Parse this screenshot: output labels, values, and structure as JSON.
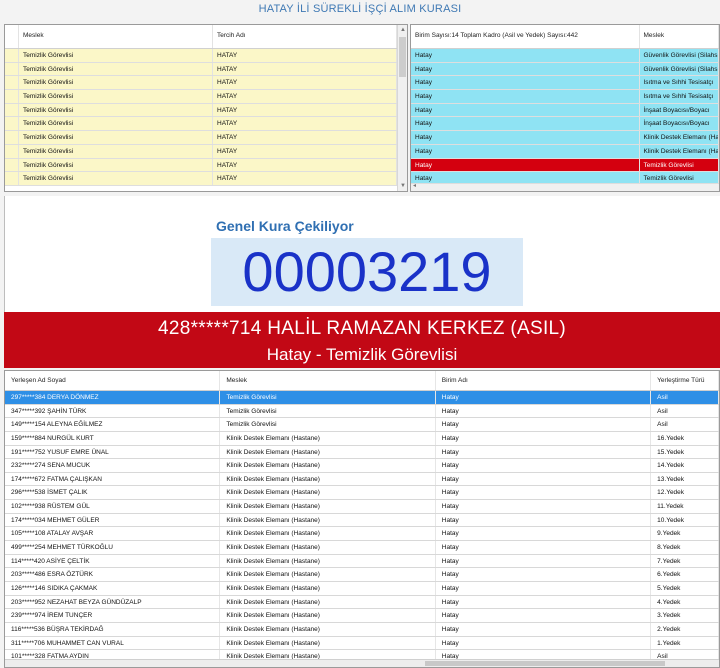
{
  "title": "HATAY İLİ SÜREKLİ İŞÇİ ALIM KURASI",
  "left_panel": {
    "columns": [
      "Meslek",
      "Tercih Adı"
    ],
    "rows": [
      [
        "Temizlik Görevlisi",
        "HATAY"
      ],
      [
        "Temizlik Görevlisi",
        "HATAY"
      ],
      [
        "Temizlik Görevlisi",
        "HATAY"
      ],
      [
        "Temizlik Görevlisi",
        "HATAY"
      ],
      [
        "Temizlik Görevlisi",
        "HATAY"
      ],
      [
        "Temizlik Görevlisi",
        "HATAY"
      ],
      [
        "Temizlik Görevlisi",
        "HATAY"
      ],
      [
        "Temizlik Görevlisi",
        "HATAY"
      ],
      [
        "Temizlik Görevlisi",
        "HATAY"
      ],
      [
        "Temizlik Görevlisi",
        "HATAY"
      ]
    ]
  },
  "right_panel": {
    "columns": [
      "Birim Sayısı:14 Toplam Kadro (Asil ve Yedek) Sayısı:442",
      "Meslek"
    ],
    "rows": [
      {
        "birim": "Hatay",
        "meslek": "Güvenlik Görevlisi (Silahsız)",
        "state": "normal"
      },
      {
        "birim": "Hatay",
        "meslek": "Güvenlik Görevlisi (Silahsız)",
        "state": "normal"
      },
      {
        "birim": "Hatay",
        "meslek": "Isıtma ve Sıhhi Tesisatçı",
        "state": "normal"
      },
      {
        "birim": "Hatay",
        "meslek": "Isıtma ve Sıhhi Tesisatçı",
        "state": "normal"
      },
      {
        "birim": "Hatay",
        "meslek": "İnşaat Boyacısı/Boyacı",
        "state": "normal"
      },
      {
        "birim": "Hatay",
        "meslek": "İnşaat Boyacısı/Boyacı",
        "state": "normal"
      },
      {
        "birim": "Hatay",
        "meslek": "Klinik Destek Elemanı (Hastane)",
        "state": "normal"
      },
      {
        "birim": "Hatay",
        "meslek": "Klinik Destek Elemanı (Hastane)",
        "state": "normal"
      },
      {
        "birim": "Hatay",
        "meslek": "Temizlik Görevlisi",
        "state": "active"
      },
      {
        "birim": "Hatay",
        "meslek": "Temizlik Görevlisi",
        "state": "normal"
      }
    ]
  },
  "draw": {
    "label": "Genel Kura Çekiliyor",
    "number": "00003219"
  },
  "winner": {
    "line1": "428*****714 HALİL RAMAZAN KERKEZ (ASIL)",
    "line2": "Hatay - Temizlik Görevlisi"
  },
  "results": {
    "columns": [
      "Yerleşen Ad Soyad",
      "Meslek",
      "Birim Adı",
      "Yerleştirme Türü"
    ],
    "rows": [
      [
        "297*****384 DERYA DÖNMEZ",
        "Temizlik Görevlisi",
        "Hatay",
        "Asil"
      ],
      [
        "347*****392 ŞAHİN TÜRK",
        "Temizlik Görevlisi",
        "Hatay",
        "Asil"
      ],
      [
        "149*****154 ALEYNA EĞİLMEZ",
        "Temizlik Görevlisi",
        "Hatay",
        "Asil"
      ],
      [
        "159*****884 NURGÜL KURT",
        "Klinik Destek Elemanı (Hastane)",
        "Hatay",
        "16.Yedek"
      ],
      [
        "191*****752 YUSUF EMRE ÜNAL",
        "Klinik Destek Elemanı (Hastane)",
        "Hatay",
        "15.Yedek"
      ],
      [
        "232*****274 SENA MUCUK",
        "Klinik Destek Elemanı (Hastane)",
        "Hatay",
        "14.Yedek"
      ],
      [
        "174*****672 FATMA ÇALIŞKAN",
        "Klinik Destek Elemanı (Hastane)",
        "Hatay",
        "13.Yedek"
      ],
      [
        "296*****538 İSMET ÇALIK",
        "Klinik Destek Elemanı (Hastane)",
        "Hatay",
        "12.Yedek"
      ],
      [
        "102*****938 RÜSTEM GÜL",
        "Klinik Destek Elemanı (Hastane)",
        "Hatay",
        "11.Yedek"
      ],
      [
        "174*****034 MEHMET GÜLER",
        "Klinik Destek Elemanı (Hastane)",
        "Hatay",
        "10.Yedek"
      ],
      [
        "105*****108 ATALAY AVŞAR",
        "Klinik Destek Elemanı (Hastane)",
        "Hatay",
        "9.Yedek"
      ],
      [
        "499*****254 MEHMET TÜRKOĞLU",
        "Klinik Destek Elemanı (Hastane)",
        "Hatay",
        "8.Yedek"
      ],
      [
        "114*****420 ASİYE ÇELTİK",
        "Klinik Destek Elemanı (Hastane)",
        "Hatay",
        "7.Yedek"
      ],
      [
        "203*****486 ESRA ÖZTÜRK",
        "Klinik Destek Elemanı (Hastane)",
        "Hatay",
        "6.Yedek"
      ],
      [
        "126*****146 SIDIKA ÇAKMAK",
        "Klinik Destek Elemanı (Hastane)",
        "Hatay",
        "5.Yedek"
      ],
      [
        "203*****952 NEZAHAT BEYZA GÜNDÜZALP",
        "Klinik Destek Elemanı (Hastane)",
        "Hatay",
        "4.Yedek"
      ],
      [
        "239*****974 İREM TUNÇER",
        "Klinik Destek Elemanı (Hastane)",
        "Hatay",
        "3.Yedek"
      ],
      [
        "116*****536 BÜŞRA TEKİRDAĞ",
        "Klinik Destek Elemanı (Hastane)",
        "Hatay",
        "2.Yedek"
      ],
      [
        "311*****706 MUHAMMET CAN VURAL",
        "Klinik Destek Elemanı (Hastane)",
        "Hatay",
        "1.Yedek"
      ],
      [
        "101*****328 FATMA AYDIN",
        "Klinik Destek Elemanı (Hastane)",
        "Hatay",
        "Asil"
      ]
    ]
  }
}
